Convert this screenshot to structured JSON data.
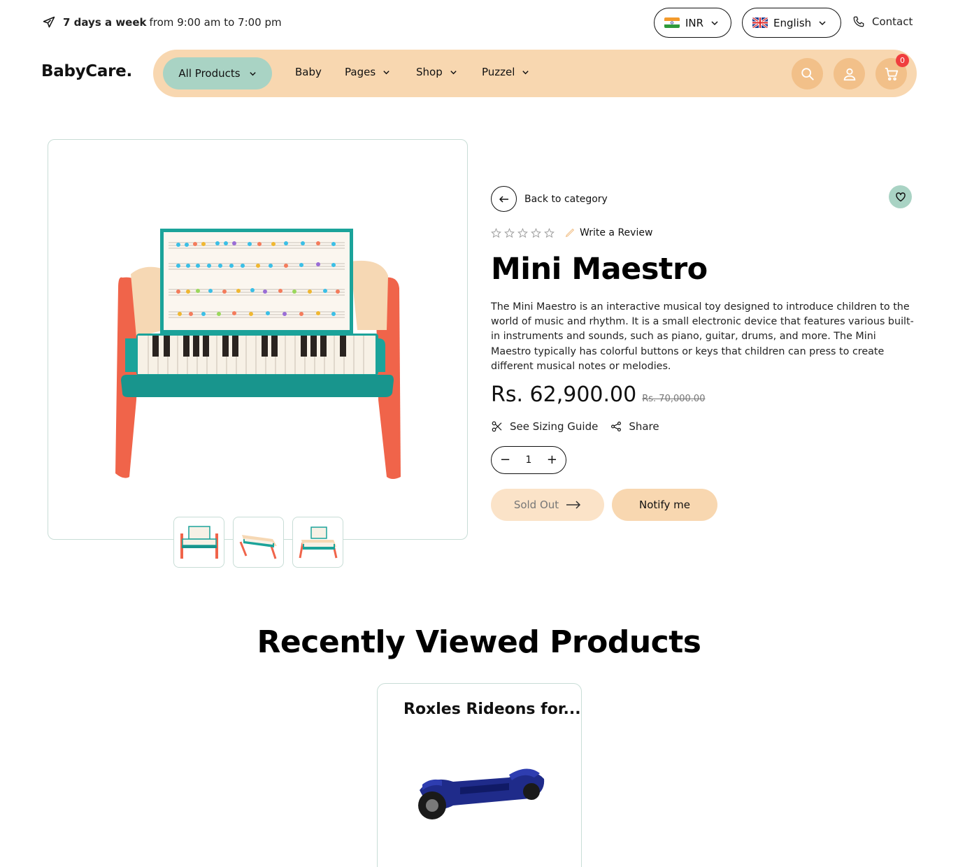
{
  "topbar": {
    "hours_bold": "7 days a week",
    "hours_rest": "from 9:00 am to 7:00 pm",
    "currency": "INR",
    "language": "English",
    "contact": "Contact"
  },
  "header": {
    "logo": "BabyCare.",
    "all_products": "All Products",
    "nav": [
      "Baby",
      "Pages",
      "Shop",
      "Puzzel"
    ],
    "cart_count": "0"
  },
  "product": {
    "back_label": "Back to category",
    "review_label": "Write a Review",
    "rating_stars": 0,
    "title": "Mini Maestro",
    "description": "The Mini Maestro is an interactive musical toy designed to introduce children to the world of music and rhythm. It is a small electronic device that features various built-in instruments and sounds, such as piano, guitar, drums, and more. The Mini Maestro typically has colorful buttons or keys that children can press to create different musical notes or melodies.",
    "price": "Rs. 62,900.00",
    "old_price": "Rs. 70,000.00",
    "sizing_label": "See Sizing Guide",
    "share_label": "Share",
    "quantity": "1",
    "sold_out_label": "Sold Out",
    "notify_label": "Notify me"
  },
  "recent": {
    "title": "Recently Viewed Products",
    "items": [
      {
        "name": "Roxles Rideons for..."
      }
    ]
  },
  "colors": {
    "nav_bg": "#f8d7b0",
    "accent_green": "#a9d3c4",
    "icon_bg": "#f2c089",
    "badge": "#f03e3e"
  }
}
